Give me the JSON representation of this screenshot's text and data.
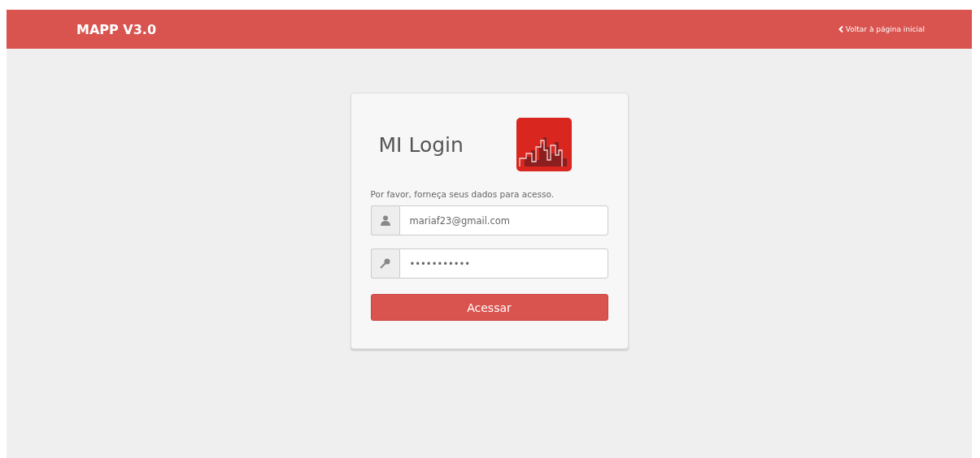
{
  "navbar": {
    "brand": "MAPP V3.0",
    "back_link": "Voltar à página inicial"
  },
  "login": {
    "title": "MI Login",
    "instructions": "Por favor, forneça seus dados para acesso.",
    "email": {
      "value": "mariaf23@gmail.com"
    },
    "password": {
      "value": "•••••••••••"
    },
    "submit": "Acessar"
  }
}
